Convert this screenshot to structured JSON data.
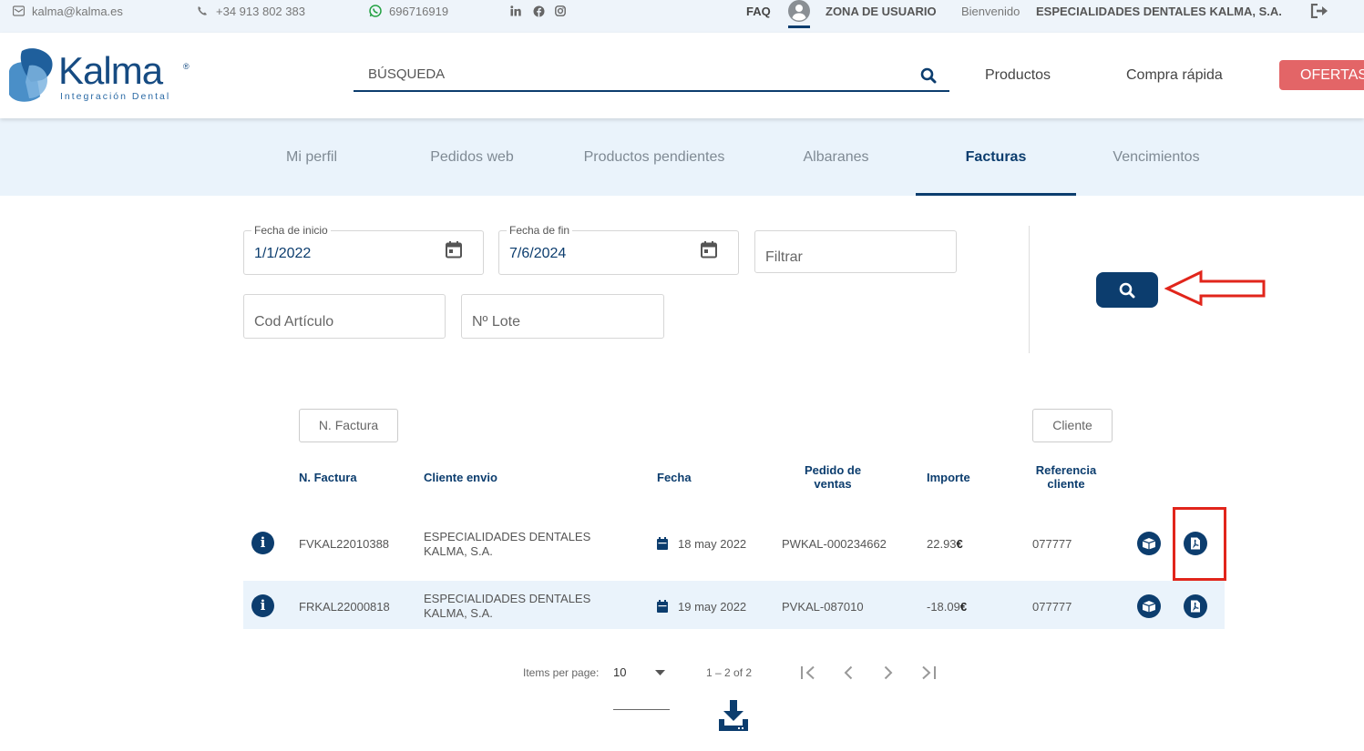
{
  "topbar": {
    "email": "kalma@kalma.es",
    "phone": "+34 913 802 383",
    "whatsapp": "696716919",
    "faq": "FAQ",
    "user_zone": "ZONA DE USUARIO",
    "welcome": "Bienvenido",
    "company": "ESPECIALIDADES DENTALES KALMA, S.A."
  },
  "header": {
    "logo_word": "Kalma",
    "logo_reg": "®",
    "logo_sub": "Integración Dental",
    "search_placeholder": "BÚSQUEDA",
    "nav_products": "Productos",
    "nav_quick": "Compra rápida",
    "nav_offers": "OFERTAS"
  },
  "tabs": [
    {
      "label": "Mi perfil",
      "active": false
    },
    {
      "label": "Pedidos web",
      "active": false
    },
    {
      "label": "Productos pendientes",
      "active": false
    },
    {
      "label": "Albaranes",
      "active": false
    },
    {
      "label": "Facturas",
      "active": true
    },
    {
      "label": "Vencimientos",
      "active": false
    }
  ],
  "filters": {
    "start_label": "Fecha de inicio",
    "start_value": "1/1/2022",
    "end_label": "Fecha de fin",
    "end_value": "7/6/2024",
    "filter_placeholder": "Filtrar",
    "article_placeholder": "Cod Artículo",
    "lot_placeholder": "Nº Lote"
  },
  "table": {
    "filter_invoice": "N. Factura",
    "filter_client": "Cliente",
    "headers": {
      "invoice": "N. Factura",
      "ship_client": "Cliente envio",
      "date": "Fecha",
      "order_line1": "Pedido de",
      "order_line2": "ventas",
      "amount": "Importe",
      "ref_line1": "Referencia",
      "ref_line2": "cliente"
    },
    "rows": [
      {
        "invoice": "FVKAL22010388",
        "client_line1": "ESPECIALIDADES DENTALES",
        "client_line2": "KALMA, S.A.",
        "date": "18 may 2022",
        "order": "PWKAL-000234662",
        "amount": "22.93",
        "currency": "€",
        "ref": "077777"
      },
      {
        "invoice": "FRKAL22000818",
        "client_line1": "ESPECIALIDADES DENTALES",
        "client_line2": "KALMA, S.A.",
        "date": "19 may 2022",
        "order": "PVKAL-087010",
        "amount": "-18.09",
        "currency": "€",
        "ref": "077777"
      }
    ]
  },
  "pagination": {
    "items_label": "Items per page:",
    "page_size": "10",
    "range": "1 – 2 of 2"
  },
  "colors": {
    "primary": "#0c3d6e",
    "accent_red": "#e1251b",
    "offers": "#e36567",
    "tab_bg": "#eaf3fb"
  }
}
